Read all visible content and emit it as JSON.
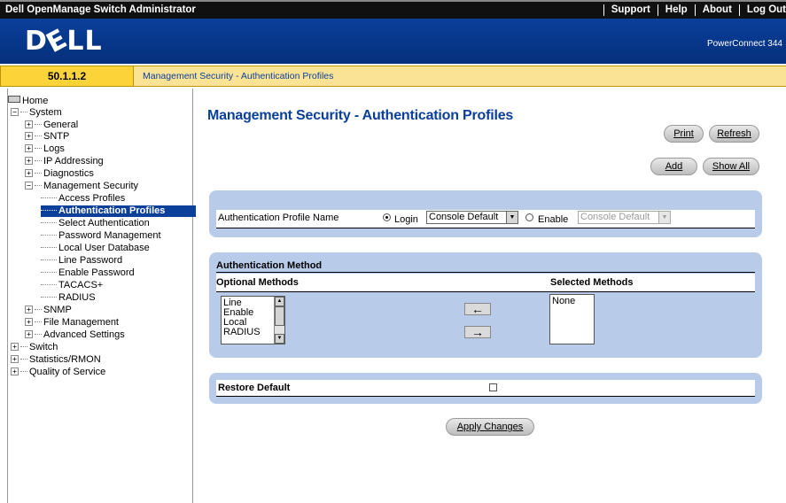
{
  "app": {
    "title": "Dell OpenManage Switch Administrator",
    "nav": [
      "Support",
      "Help",
      "About",
      "Log Out"
    ],
    "logo": "DELL",
    "model": "PowerConnect 344"
  },
  "strip": {
    "ip": "50.1.1.2",
    "breadcrumb": "Management Security - Authentication Profiles"
  },
  "tree": {
    "home": "Home",
    "system": "System",
    "general": "General",
    "sntp": "SNTP",
    "logs": "Logs",
    "ip_addressing": "IP Addressing",
    "diagnostics": "Diagnostics",
    "mgmt_security": "Management Security",
    "access_profiles": "Access Profiles",
    "auth_profiles": "Authentication Profiles",
    "select_auth": "Select Authentication",
    "password_mgmt": "Password Management",
    "local_user_db": "Local User Database",
    "line_password": "Line Password",
    "enable_password": "Enable Password",
    "tacacs": "TACACS+",
    "radius": "RADIUS",
    "snmp": "SNMP",
    "file_mgmt": "File Management",
    "advanced": "Advanced Settings",
    "switch": "Switch",
    "stats": "Statistics/RMON",
    "qos": "Quality of Service"
  },
  "page": {
    "title": "Management Security - Authentication Profiles",
    "buttons": {
      "print": "Print",
      "refresh": "Refresh",
      "add": "Add",
      "show_all": "Show All",
      "apply": "Apply Changes"
    }
  },
  "profile": {
    "label": "Authentication Profile Name",
    "login_label": "Login",
    "login_value": "Console Default",
    "enable_label": "Enable",
    "enable_value": "Console Default"
  },
  "methods": {
    "section_title": "Authentication Method",
    "optional_header": "Optional Methods",
    "selected_header": "Selected Methods",
    "optional": [
      "Line",
      "Enable",
      "Local",
      "RADIUS"
    ],
    "selected": [
      "None"
    ],
    "add_arrow": "←",
    "remove_arrow": "→"
  },
  "restore": {
    "label": "Restore Default",
    "checked": false
  }
}
